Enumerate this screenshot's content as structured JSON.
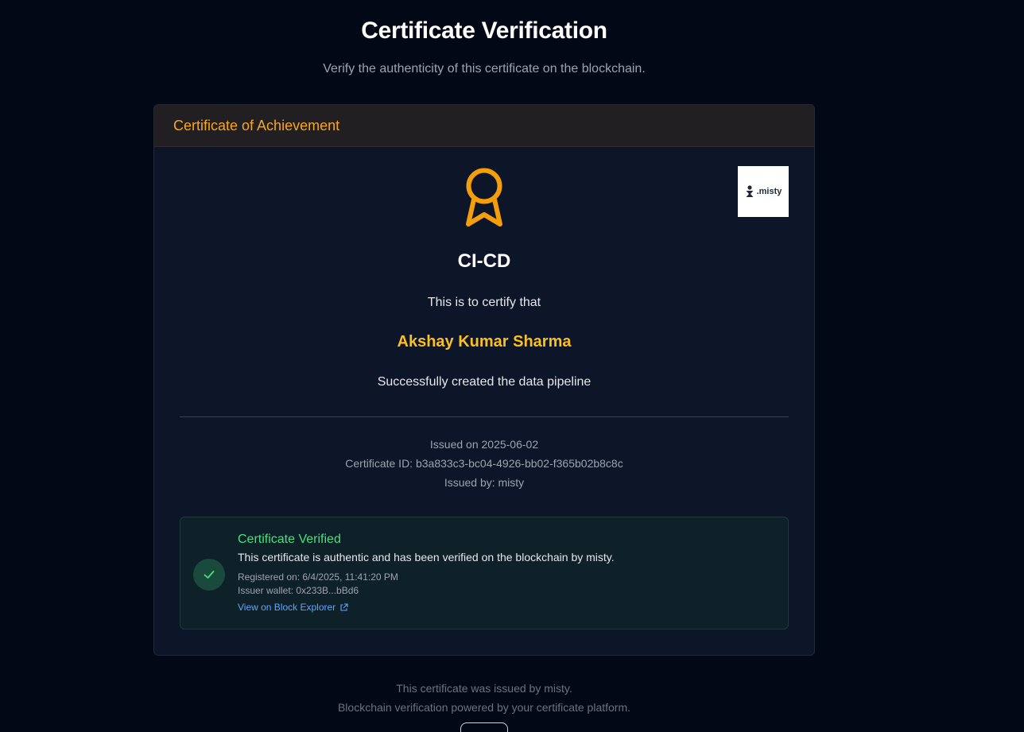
{
  "header": {
    "title": "Certificate Verification",
    "subtitle": "Verify the authenticity of this certificate on the blockchain."
  },
  "certificate": {
    "header_title": "Certificate of Achievement",
    "award_icon": "award-ribbon-icon",
    "issuer_logo_text": ".misty",
    "course": "CI-CD",
    "certify_text": "This is to certify that",
    "recipient": "Akshay Kumar Sharma",
    "description": "Successfully created the data pipeline",
    "issued_on": "Issued on 2025-06-02",
    "certificate_id": "Certificate ID: b3a833c3-bc04-4926-bb02-f365b02b8c8c",
    "issued_by": "Issued by: misty"
  },
  "verification": {
    "icon": "check-icon",
    "title": "Certificate Verified",
    "description": "This certificate is authentic and has been verified on the blockchain by misty.",
    "registered_on": "Registered on: 6/4/2025, 11:41:20 PM",
    "issuer_wallet": "Issuer wallet: 0x233B...bBd6",
    "explorer_link": "View on Block Explorer",
    "explorer_icon": "external-link-icon"
  },
  "footer": {
    "line1": "This certificate was issued by misty.",
    "line2": "Blockchain verification powered by your certificate platform."
  },
  "colors": {
    "background": "#030816",
    "card": "#0d1528",
    "accent": "#f5a623",
    "verified": "#4ade80",
    "link": "#60a5fa"
  }
}
